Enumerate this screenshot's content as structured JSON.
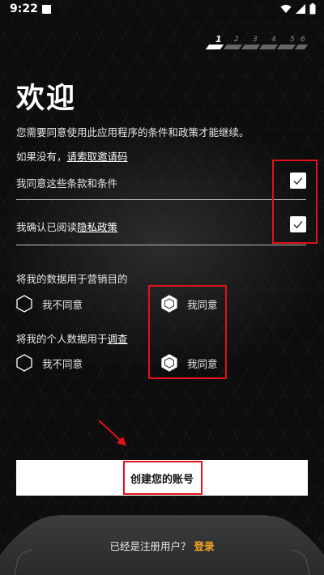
{
  "status_bar": {
    "time": "9:22"
  },
  "steps": {
    "labels": [
      "1",
      "2",
      "3",
      "4",
      "5",
      "6"
    ],
    "current": 1
  },
  "title": "欢迎",
  "subtitle": "您需要同意使用此应用程序的条件和政策才能继续。",
  "invite": {
    "prefix": "如果没有，",
    "link": "请索取邀请码"
  },
  "terms": {
    "label": "我同意这些条款和条件",
    "checked": true
  },
  "privacy": {
    "prefix": "我确认已阅读",
    "link": "隐私政策",
    "checked": true
  },
  "marketing": {
    "question": "将我的数据用于营销目的",
    "disagree": "我不同意",
    "agree": "我同意",
    "selected": "agree"
  },
  "survey": {
    "question_prefix": "将我的个人数据用于",
    "question_link": "调查",
    "disagree": "我不同意",
    "agree": "我同意",
    "selected": "agree"
  },
  "create_button": "创建您的账号",
  "footer": {
    "text": "已经是注册用户？",
    "login": "登录"
  },
  "colors": {
    "accent": "#f5a623",
    "highlight": "#e0121b",
    "background": "#0d0d0d"
  }
}
